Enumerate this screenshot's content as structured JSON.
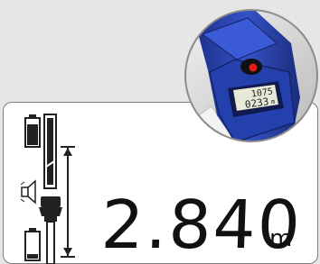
{
  "display": {
    "distance_value": "2.840",
    "distance_unit": "m"
  },
  "device_screen": {
    "line1_value": "1075",
    "line2_value": "0233",
    "line2_unit": "m"
  },
  "icons": {
    "battery_top": "battery-full-icon",
    "speaker": "speaker-icon",
    "battery_bottom": "battery-low-icon",
    "measure_reference": "measure-reference-icon",
    "laser_button": "laser-button-icon"
  },
  "colors": {
    "device_blue": "#2f49b8",
    "laser_red": "#e11b1b",
    "lcd_background": "#ffffff"
  }
}
